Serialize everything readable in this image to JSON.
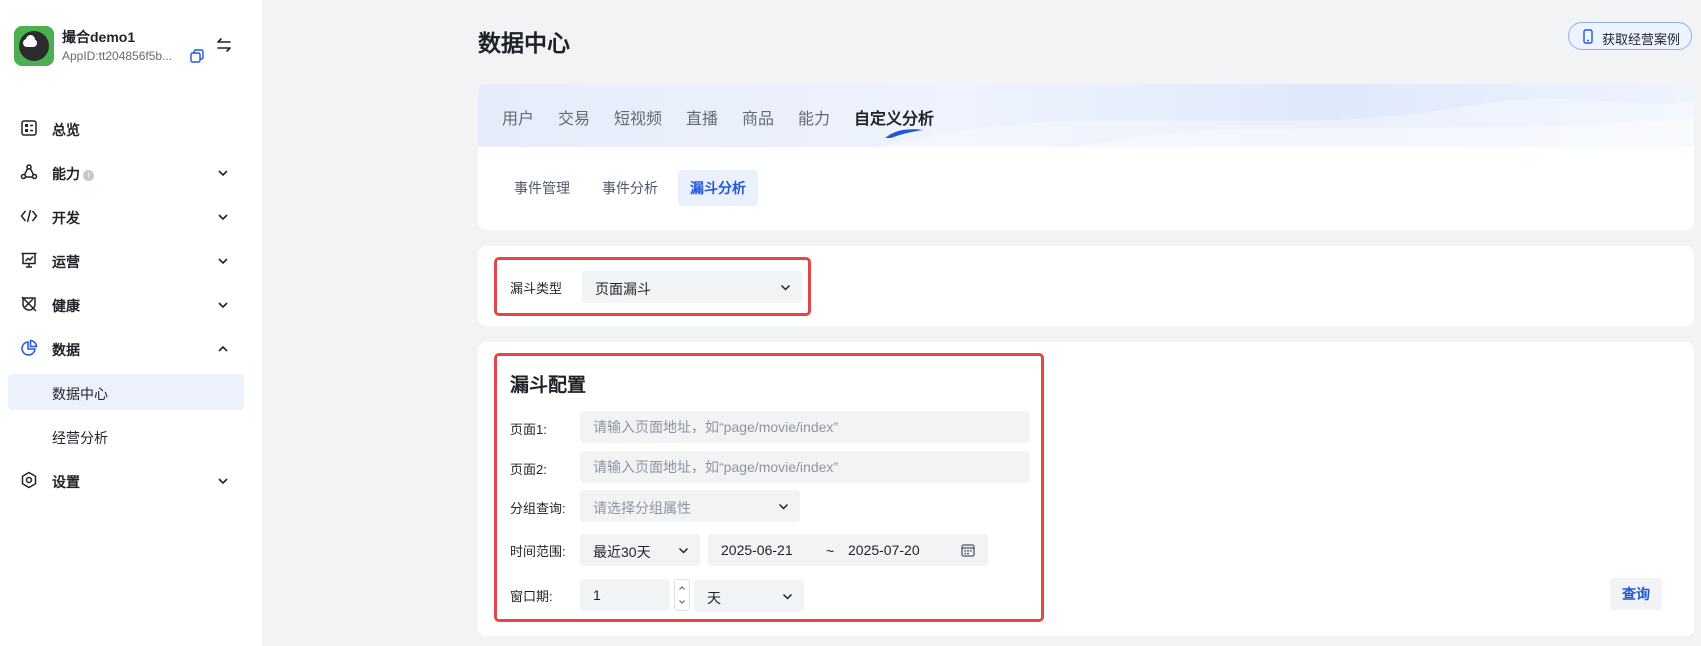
{
  "app": {
    "name": "撮合demo1",
    "id": "AppID:tt204856f5b..."
  },
  "sidebar": {
    "items": [
      {
        "label": "总览"
      },
      {
        "label": "能力",
        "info": "i"
      },
      {
        "label": "开发"
      },
      {
        "label": "运营"
      },
      {
        "label": "健康"
      },
      {
        "label": "数据"
      },
      {
        "label": "设置"
      }
    ],
    "data_sub": [
      {
        "label": "数据中心"
      },
      {
        "label": "经营分析"
      }
    ]
  },
  "header": {
    "title": "数据中心",
    "case_button": "获取经营案例"
  },
  "top_tabs": [
    "用户",
    "交易",
    "短视频",
    "直播",
    "商品",
    "能力",
    "自定义分析"
  ],
  "sub_tabs": [
    "事件管理",
    "事件分析",
    "漏斗分析"
  ],
  "funnel_type": {
    "label": "漏斗类型",
    "value": "页面漏斗"
  },
  "config": {
    "title": "漏斗配置",
    "page1_label": "页面1:",
    "page1_placeholder": "请输入页面地址，如“page/movie/index”",
    "page2_label": "页面2:",
    "page2_placeholder": "请输入页面地址，如“page/movie/index”",
    "group_label": "分组查询:",
    "group_placeholder": "请选择分组属性",
    "time_label": "时间范围:",
    "time_range": "最近30天",
    "date_start": "2025-06-21",
    "date_sep": "~",
    "date_end": "2025-07-20",
    "window_label": "窗口期:",
    "window_value": "1",
    "window_unit": "天",
    "query_button": "查询"
  },
  "colors": {
    "accent": "#2257d6",
    "highlight": "#e04848",
    "background": "#f2f3f5"
  }
}
